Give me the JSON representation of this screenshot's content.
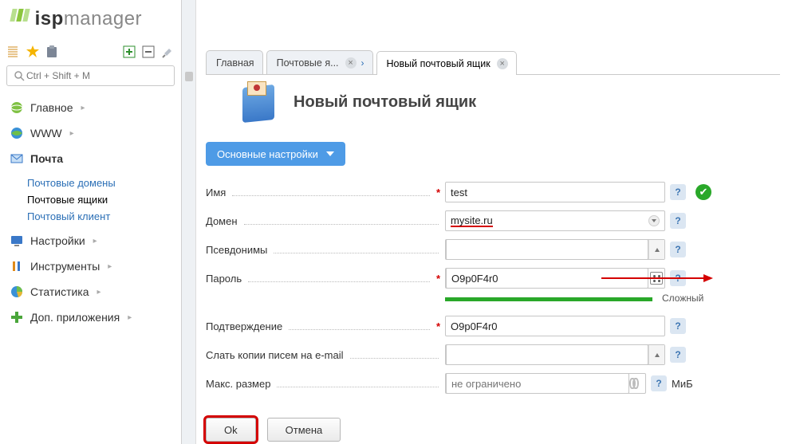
{
  "logo": {
    "bold": "isp",
    "light": "manager"
  },
  "search": {
    "placeholder": "Ctrl + Shift + M"
  },
  "sidebar": {
    "items": {
      "main": {
        "label": "Главное"
      },
      "www": {
        "label": "WWW"
      },
      "mail": {
        "label": "Почта",
        "sub": {
          "domains": "Почтовые домены",
          "boxes": "Почтовые ящики",
          "client": "Почтовый клиент"
        }
      },
      "settings": {
        "label": "Настройки"
      },
      "tools": {
        "label": "Инструменты"
      },
      "stats": {
        "label": "Статистика"
      },
      "apps": {
        "label": "Доп. приложения"
      }
    }
  },
  "tabs": {
    "t1": {
      "label": "Главная"
    },
    "t2": {
      "label": "Почтовые я..."
    },
    "t3": {
      "label": "Новый почтовый ящик"
    }
  },
  "page": {
    "title": "Новый почтовый ящик",
    "section_btn": "Основные настройки"
  },
  "form": {
    "name": {
      "label": "Имя",
      "value": "test"
    },
    "domain": {
      "label": "Домен",
      "value": "mysite.ru"
    },
    "aliases": {
      "label": "Псевдонимы",
      "value": ""
    },
    "password": {
      "label": "Пароль",
      "value": "O9p0F4r0",
      "strength": "Сложный"
    },
    "confirm": {
      "label": "Подтверждение",
      "value": "O9p0F4r0"
    },
    "copies": {
      "label": "Слать копии писем на e-mail",
      "value": ""
    },
    "maxsize": {
      "label": "Макс. размер",
      "placeholder": "не ограничено",
      "unit": "МиБ"
    }
  },
  "buttons": {
    "ok": "Ok",
    "cancel": "Отмена"
  }
}
